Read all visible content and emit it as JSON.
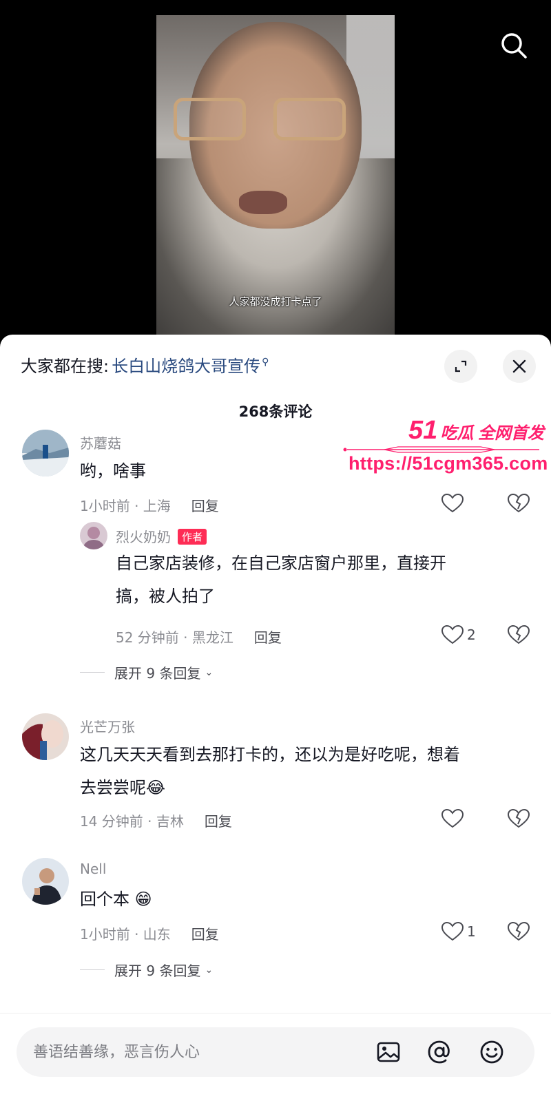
{
  "video": {
    "subtitle": "人家都没成打卡点了"
  },
  "panel": {
    "hot_search_prefix": "大家都在搜:",
    "hot_search_term": "长白山烧鸽大哥宣传",
    "comment_count": "268条评论"
  },
  "watermark": {
    "number": "51",
    "slogan": "吃瓜 全网首发",
    "url": "https://51cgm365.com"
  },
  "comments": [
    {
      "user": "苏蘑菇",
      "text": "哟，啥事",
      "meta": "1小时前 · 上海",
      "reply": "回复",
      "likes": "",
      "replies": [
        {
          "user": "烈火奶奶",
          "badge": "作者",
          "text_line1": "自己家店装修，在自己家店窗户那里，直接开",
          "text_line2": "搞，被人拍了",
          "meta": "52 分钟前 · 黑龙江",
          "reply": "回复",
          "likes": "2"
        }
      ],
      "expand": "展开 9 条回复"
    },
    {
      "user": "光芒万张",
      "text_line1": "这几天天天看到去那打卡的，还以为是好吃呢，想着",
      "text_line2": "去尝尝呢",
      "emoji": "😂",
      "meta": "14 分钟前 · 吉林",
      "reply": "回复",
      "likes": ""
    },
    {
      "user": "Nell",
      "text": "回个本",
      "emoji": "😁",
      "meta": "1小时前 · 山东",
      "reply": "回复",
      "likes": "1",
      "expand": "展开 9 条回复"
    }
  ],
  "input": {
    "placeholder": "善语结善缘，恶言伤人心"
  },
  "icons": {
    "search": "search-icon",
    "expand": "expand-icon",
    "close": "close-icon",
    "like": "heart-icon",
    "dislike": "broken-heart-icon",
    "image": "image-icon",
    "mention": "at-icon",
    "emoji": "emoji-icon"
  },
  "colors": {
    "accent_link": "#2a4a7f",
    "author_badge": "#fe2c55",
    "watermark": "#ff1f6e"
  }
}
